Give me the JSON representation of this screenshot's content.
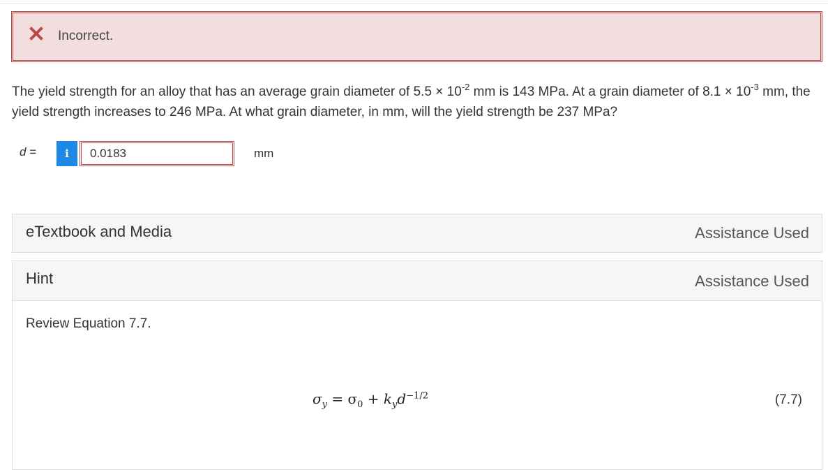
{
  "feedback": {
    "icon": "close-icon",
    "text": "Incorrect.",
    "color": "#b94a48",
    "background": "#f2dede"
  },
  "question": {
    "part1": "The yield strength for an alloy that has an average grain diameter of 5.5 × 10",
    "exp1": "-2",
    "part2": " mm is 143 MPa. At a grain diameter of 8.1 × 10",
    "exp2": "-3",
    "part3": " mm, the yield strength increases to 246 MPa. At what grain diameter, in mm, will the yield strength be 237 MPa?"
  },
  "answer": {
    "variable": "d",
    "equals": " =",
    "info_icon": "info-icon",
    "value": "0.0183",
    "unit": "mm"
  },
  "ebook_panel": {
    "title": "eTextbook and Media",
    "status": "Assistance Used"
  },
  "hint_panel": {
    "title": "Hint",
    "status": "Assistance Used",
    "text": "Review Equation 7.7.",
    "equation": {
      "sigma_y": "σ",
      "sub_y": "y",
      "equals": " = ",
      "sigma_0": "σ",
      "sub_0": "0",
      "plus": " + ",
      "k": "k",
      "sub_ky": "y",
      "d": "d",
      "exponent": "−1/2"
    },
    "equation_number": "(7.7)"
  },
  "colors": {
    "accent": "#1e88e5",
    "error_border": "#b94a48"
  }
}
